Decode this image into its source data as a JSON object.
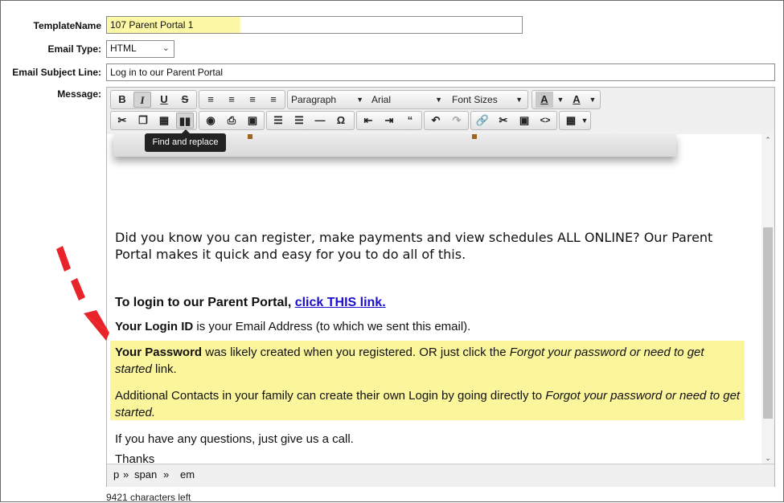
{
  "form": {
    "template_name_label": "TemplateName",
    "template_name_value": "107 Parent Portal 1",
    "email_type_label": "Email Type:",
    "email_type_value": "HTML",
    "subject_label": "Email Subject Line:",
    "subject_value": "Log in to our Parent Portal",
    "message_label": "Message:"
  },
  "toolbar": {
    "bold": "B",
    "italic": "I",
    "underline": "U",
    "strike": "S",
    "paragraph": "Paragraph",
    "font": "Arial",
    "font_sizes": "Font Sizes",
    "text_color": "A",
    "bg_color": "A",
    "tooltip": "Find and replace"
  },
  "content": {
    "p1": "Did you know you can register, make payments and view schedules ALL ONLINE? Our Parent Portal makes it quick and easy for you to do all of this.",
    "p2_text": "To login to our Parent Portal, ",
    "p2_link": "click THIS link.",
    "p3_bold": "Your Login ID",
    "p3_text": " is your Email Address (to which we sent this email).",
    "p4_bold": "Your Password",
    "p4_text": " was likely created when you registered. OR just click the ",
    "p4_italic": "Forgot your password or need to get started",
    "p4_end": " link.",
    "p5_text": "Additional Contacts in your family can create their own Login by going directly to ",
    "p5_italic": "Forgot your password or need to get started.",
    "p6": "If you have any questions, just give us a call.",
    "p7": "Thanks"
  },
  "status": {
    "p": "p",
    "sep1": "»",
    "span": "span",
    "sep2": "»",
    "em": "em"
  },
  "footer": {
    "chars_left": "9421 characters left"
  },
  "colors": {
    "highlight": "#fbf69c",
    "arrow": "#e8232a",
    "link": "#1a0dcc"
  }
}
